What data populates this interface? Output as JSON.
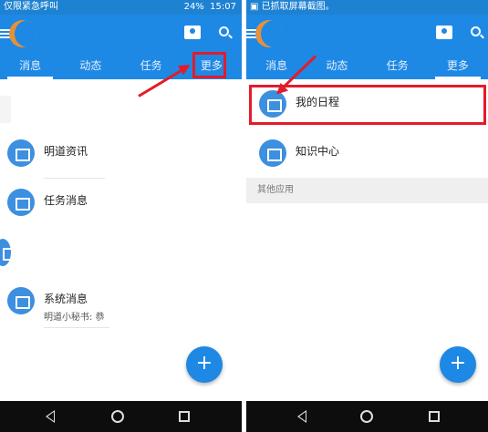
{
  "left_screen": {
    "status": {
      "left_text": "仅限紧急呼叫",
      "battery": "24%",
      "time": "15:07"
    },
    "tabs": [
      "消息",
      "动态",
      "任务",
      "更多"
    ],
    "items": [
      {
        "label": "明道资讯",
        "subtitle": ""
      },
      {
        "label": "任务消息",
        "subtitle": ""
      },
      {
        "label": "系统消息",
        "subtitle": "明道小秘书: 恭"
      }
    ],
    "fab_label": "+"
  },
  "right_screen": {
    "status": {
      "left_text": "已抓取屏幕截图。"
    },
    "tabs": [
      "消息",
      "动态",
      "任务",
      "更多"
    ],
    "items": [
      {
        "label": "我的日程"
      },
      {
        "label": "知识中心"
      }
    ],
    "section_header": "其他应用",
    "fab_label": "+"
  },
  "icons": {
    "menu": "menu-icon",
    "contacts": "contacts-icon",
    "search": "search-icon",
    "calendar": "calendar-icon",
    "card": "card-icon",
    "message": "message-icon",
    "task": "task-icon",
    "speaker": "speaker-icon"
  },
  "colors": {
    "primary": "#1e88e5",
    "annotation": "#e21c2a",
    "navbar": "#0d0d0d"
  }
}
